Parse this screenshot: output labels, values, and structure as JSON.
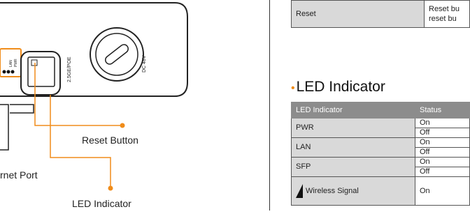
{
  "callouts": {
    "reset_button": "Reset Button",
    "ethernet_port": "rnet Port",
    "led_indicator": "LED Indicator"
  },
  "device_labels": {
    "poe_port": "2.5GE/POE",
    "dc_input": "DC 48V",
    "led_small_1": "LAN",
    "led_small_2": "PWR"
  },
  "reset_table": {
    "name": "Reset",
    "description": "Reset bu\nreset bu"
  },
  "led_section": {
    "title": "LED Indicator",
    "headers": [
      "LED Indicator",
      "Status"
    ],
    "rows": [
      {
        "indicator": "PWR",
        "statuses": [
          "On",
          "Off"
        ]
      },
      {
        "indicator": "LAN",
        "statuses": [
          "On",
          "Off"
        ]
      },
      {
        "indicator": "SFP",
        "statuses": [
          "On",
          "Off"
        ]
      },
      {
        "indicator": "Wireless Signal",
        "statuses": [
          "On"
        ]
      }
    ]
  },
  "colors": {
    "accent": "#f08c1a",
    "header_bg": "#8c8c8c",
    "cell_bg": "#d9d9d9"
  }
}
